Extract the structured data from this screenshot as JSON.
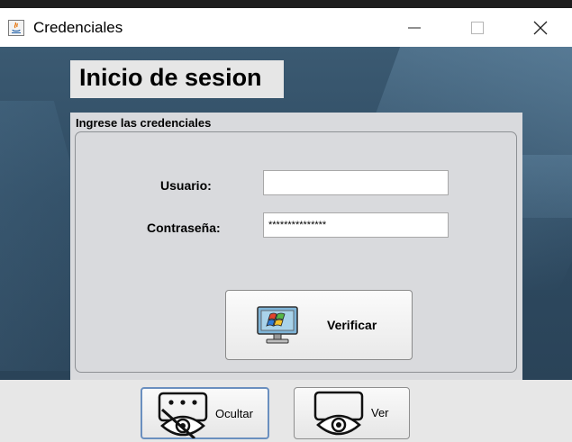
{
  "window": {
    "title": "Credenciales",
    "icon": "java-icon",
    "controls": {
      "minimize": "minimize-icon",
      "maximize": "maximize-icon",
      "close": "close-icon"
    }
  },
  "header": {
    "title": "Inicio de sesion"
  },
  "form": {
    "section_title": "Ingrese las credenciales",
    "username_label": "Usuario:",
    "username_value": "",
    "password_label": "Contraseña:",
    "password_value": "***************",
    "verify_button": {
      "label": "Verificar",
      "icon": "monitor-windows-logo-icon"
    }
  },
  "bottom": {
    "hide_button": {
      "label": "Ocultar",
      "icon": "hidden-eye-icon"
    },
    "show_button": {
      "label": "Ver",
      "icon": "eye-icon"
    }
  },
  "colors": {
    "background": "#2f4b62",
    "panel": "#d9dadd",
    "bottom_bar": "#e7e7e7"
  }
}
